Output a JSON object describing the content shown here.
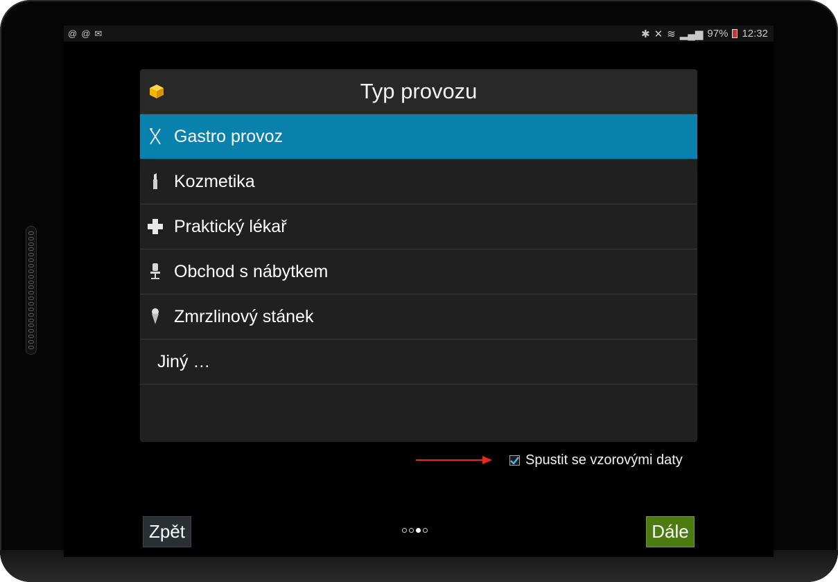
{
  "statusbar": {
    "left_icons": [
      "@",
      "@",
      "✉"
    ],
    "battery": "97%",
    "time": "12:32"
  },
  "dialog": {
    "title": "Typ provozu",
    "items": [
      {
        "label": "Gastro provoz",
        "icon": "fork-knife-icon",
        "selected": true
      },
      {
        "label": "Kozmetika",
        "icon": "lipstick-icon",
        "selected": false
      },
      {
        "label": "Praktický lékař",
        "icon": "cross-icon",
        "selected": false
      },
      {
        "label": "Obchod s nábytkem",
        "icon": "chair-icon",
        "selected": false
      },
      {
        "label": "Zmrzlinový stánek",
        "icon": "ice-cream-icon",
        "selected": false
      },
      {
        "label": "Jiný …",
        "icon": "",
        "selected": false
      }
    ]
  },
  "sample_data_checkbox": {
    "label": "Spustit se vzorovými daty",
    "checked": true
  },
  "annotation": {
    "color": "#e8281c"
  },
  "nav": {
    "back_label": "Zpět",
    "next_label": "Dále",
    "page_count": 4,
    "active_page": 3
  },
  "colors": {
    "selected": "#0882ad",
    "next_button": "#4d7a12",
    "accent_icon": "#f5b800"
  }
}
